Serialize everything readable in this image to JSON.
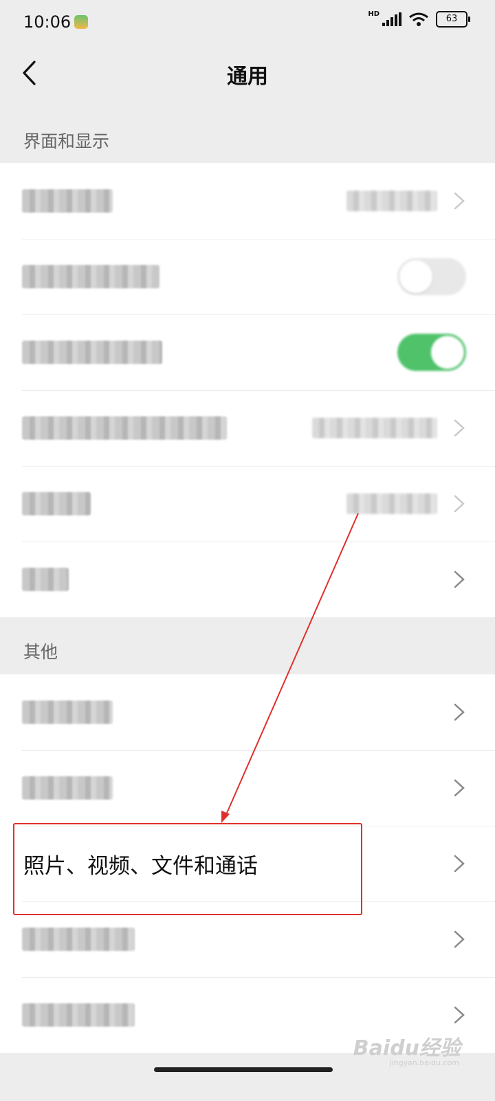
{
  "status_bar": {
    "time": "10:06",
    "network_label": "HD",
    "battery_level": "63"
  },
  "nav": {
    "title": "通用"
  },
  "sections": {
    "display": {
      "label": "界面和显示"
    },
    "other": {
      "label": "其他"
    }
  },
  "rows": {
    "photos": {
      "label": "照片、视频、文件和通话"
    }
  },
  "watermark": {
    "logo": "Baidu经验",
    "url": "jingyan.baidu.com"
  },
  "colors": {
    "accent_green": "#4fc26a",
    "highlight_red": "#e0302c"
  }
}
